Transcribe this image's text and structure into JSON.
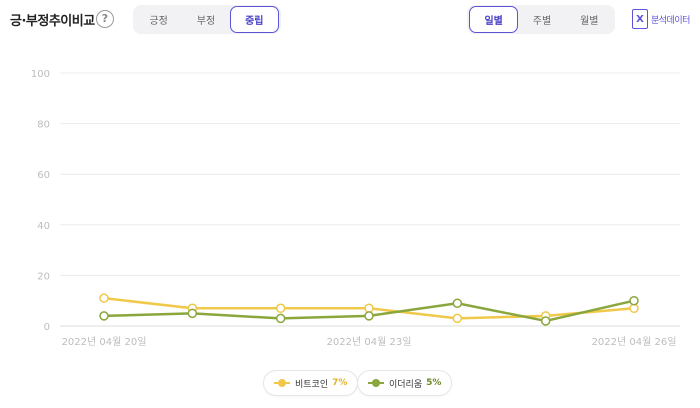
{
  "header": {
    "title": "긍·부정추이비교",
    "help_glyph": "?",
    "sentiment_tabs": [
      {
        "label": "긍정",
        "active": false
      },
      {
        "label": "부정",
        "active": false
      },
      {
        "label": "중립",
        "active": true
      }
    ],
    "period_tabs": [
      {
        "label": "일별",
        "active": true
      },
      {
        "label": "주별",
        "active": false
      },
      {
        "label": "월별",
        "active": false
      }
    ],
    "export_label": "분석데이터",
    "export_icon": "excel-icon"
  },
  "legend": [
    {
      "label": "비트코인",
      "pct": "7%",
      "color": "#f0c84a"
    },
    {
      "label": "이더리움",
      "pct": "5%",
      "color": "#8aa63c"
    }
  ],
  "chart_data": {
    "type": "line",
    "x": [
      "2022년 04월 20일",
      "2022-04-21",
      "2022-04-22",
      "2022년 04월 23일",
      "2022-04-24",
      "2022-04-25",
      "2022년 04월 26일"
    ],
    "x_tick_labels": [
      "2022년 04월 20일",
      "2022년 04월 23일",
      "2022년 04월 26일"
    ],
    "y_ticks": [
      "0",
      "20",
      "40",
      "60",
      "80",
      "100"
    ],
    "ylim": [
      0,
      100
    ],
    "grid": true,
    "series": [
      {
        "name": "비트코인",
        "color": "#f0c84a",
        "values": [
          11,
          7,
          7,
          7,
          3,
          4,
          7
        ]
      },
      {
        "name": "이더리움",
        "color": "#8aa63c",
        "values": [
          4,
          5,
          3,
          4,
          9,
          2,
          10
        ]
      }
    ],
    "legend_position": "bottom-center"
  }
}
